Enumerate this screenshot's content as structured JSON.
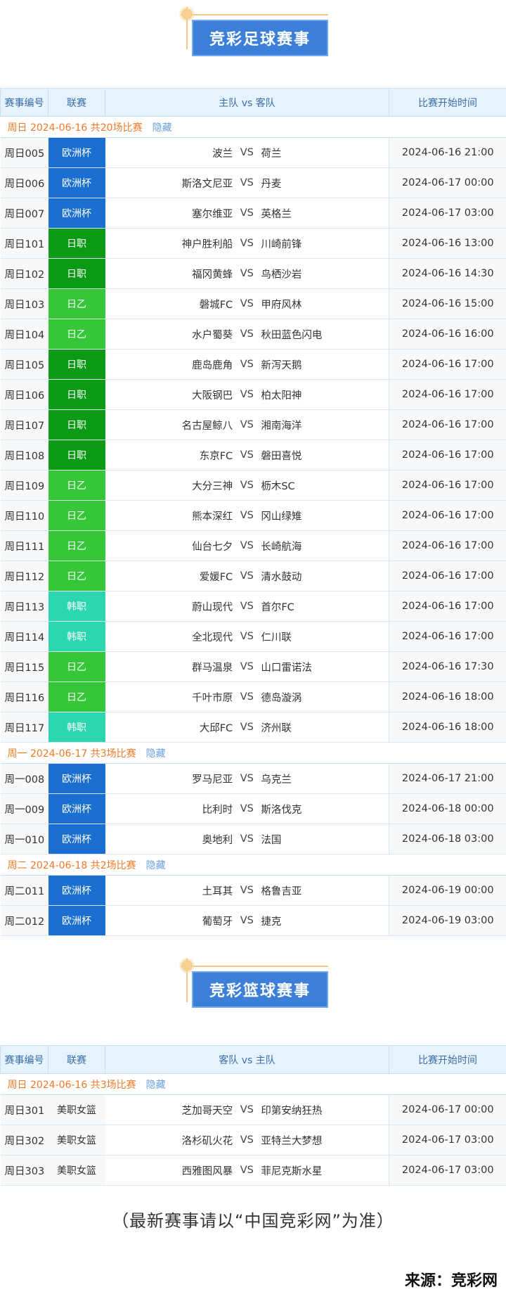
{
  "football": {
    "title": "竞彩足球赛事",
    "headers": [
      "赛事编号",
      "联赛",
      "主队 vs 客队",
      "比赛开始时间"
    ],
    "hide_label": "隐藏",
    "groups": [
      {
        "date_label": "周日 2024-06-16 共20场比赛",
        "matches": [
          {
            "num": "周日005",
            "league": "欧洲杯",
            "lg": "euro",
            "home": "波兰",
            "away": "荷兰",
            "time": "2024-06-16 21:00"
          },
          {
            "num": "周日006",
            "league": "欧洲杯",
            "lg": "euro",
            "home": "斯洛文尼亚",
            "away": "丹麦",
            "time": "2024-06-17 00:00"
          },
          {
            "num": "周日007",
            "league": "欧洲杯",
            "lg": "euro",
            "home": "塞尔维亚",
            "away": "英格兰",
            "time": "2024-06-17 03:00"
          },
          {
            "num": "周日101",
            "league": "日职",
            "lg": "j1",
            "home": "神户胜利船",
            "away": "川崎前锋",
            "time": "2024-06-16 13:00"
          },
          {
            "num": "周日102",
            "league": "日职",
            "lg": "j1",
            "home": "福冈黄蜂",
            "away": "鸟栖沙岩",
            "time": "2024-06-16 14:30"
          },
          {
            "num": "周日103",
            "league": "日乙",
            "lg": "j2",
            "home": "磐城FC",
            "away": "甲府风林",
            "time": "2024-06-16 15:00"
          },
          {
            "num": "周日104",
            "league": "日乙",
            "lg": "j2",
            "home": "水户蜀葵",
            "away": "秋田蓝色闪电",
            "time": "2024-06-16 16:00"
          },
          {
            "num": "周日105",
            "league": "日职",
            "lg": "j1",
            "home": "鹿岛鹿角",
            "away": "新泻天鹅",
            "time": "2024-06-16 17:00"
          },
          {
            "num": "周日106",
            "league": "日职",
            "lg": "j1",
            "home": "大阪钢巴",
            "away": "柏太阳神",
            "time": "2024-06-16 17:00"
          },
          {
            "num": "周日107",
            "league": "日职",
            "lg": "j1",
            "home": "名古屋鲸八",
            "away": "湘南海洋",
            "time": "2024-06-16 17:00"
          },
          {
            "num": "周日108",
            "league": "日职",
            "lg": "j1",
            "home": "东京FC",
            "away": "磐田喜悦",
            "time": "2024-06-16 17:00"
          },
          {
            "num": "周日109",
            "league": "日乙",
            "lg": "j2",
            "home": "大分三神",
            "away": "枥木SC",
            "time": "2024-06-16 17:00"
          },
          {
            "num": "周日110",
            "league": "日乙",
            "lg": "j2",
            "home": "熊本深红",
            "away": "冈山绿雉",
            "time": "2024-06-16 17:00"
          },
          {
            "num": "周日111",
            "league": "日乙",
            "lg": "j2",
            "home": "仙台七夕",
            "away": "长崎航海",
            "time": "2024-06-16 17:00"
          },
          {
            "num": "周日112",
            "league": "日乙",
            "lg": "j2",
            "home": "爱媛FC",
            "away": "清水鼓动",
            "time": "2024-06-16 17:00"
          },
          {
            "num": "周日113",
            "league": "韩职",
            "lg": "k1",
            "home": "蔚山现代",
            "away": "首尔FC",
            "time": "2024-06-16 17:00"
          },
          {
            "num": "周日114",
            "league": "韩职",
            "lg": "k1",
            "home": "全北现代",
            "away": "仁川联",
            "time": "2024-06-16 17:00"
          },
          {
            "num": "周日115",
            "league": "日乙",
            "lg": "j2",
            "home": "群马温泉",
            "away": "山口雷诺法",
            "time": "2024-06-16 17:30"
          },
          {
            "num": "周日116",
            "league": "日乙",
            "lg": "j2",
            "home": "千叶市原",
            "away": "德岛漩涡",
            "time": "2024-06-16 18:00"
          },
          {
            "num": "周日117",
            "league": "韩职",
            "lg": "k1",
            "home": "大邱FC",
            "away": "济州联",
            "time": "2024-06-16 18:00"
          }
        ]
      },
      {
        "date_label": "周一 2024-06-17 共3场比赛",
        "matches": [
          {
            "num": "周一008",
            "league": "欧洲杯",
            "lg": "euro",
            "home": "罗马尼亚",
            "away": "乌克兰",
            "time": "2024-06-17 21:00"
          },
          {
            "num": "周一009",
            "league": "欧洲杯",
            "lg": "euro",
            "home": "比利时",
            "away": "斯洛伐克",
            "time": "2024-06-18 00:00"
          },
          {
            "num": "周一010",
            "league": "欧洲杯",
            "lg": "euro",
            "home": "奥地利",
            "away": "法国",
            "time": "2024-06-18 03:00"
          }
        ]
      },
      {
        "date_label": "周二 2024-06-18 共2场比赛",
        "matches": [
          {
            "num": "周二011",
            "league": "欧洲杯",
            "lg": "euro",
            "home": "土耳其",
            "away": "格鲁吉亚",
            "time": "2024-06-19 00:00"
          },
          {
            "num": "周二012",
            "league": "欧洲杯",
            "lg": "euro",
            "home": "葡萄牙",
            "away": "捷克",
            "time": "2024-06-19 03:00"
          }
        ]
      }
    ]
  },
  "basketball": {
    "title": "竞彩篮球赛事",
    "headers": [
      "赛事编号",
      "联赛",
      "客队 vs 主队",
      "比赛开始时间"
    ],
    "hide_label": "隐藏",
    "groups": [
      {
        "date_label": "周日 2024-06-16 共3场比赛",
        "matches": [
          {
            "num": "周日301",
            "league": "美职女篮",
            "lg": "wnba",
            "home": "芝加哥天空",
            "away": "印第安纳狂热",
            "time": "2024-06-17 00:00"
          },
          {
            "num": "周日302",
            "league": "美职女篮",
            "lg": "wnba",
            "home": "洛杉矶火花",
            "away": "亚特兰大梦想",
            "time": "2024-06-17 03:00"
          },
          {
            "num": "周日303",
            "league": "美职女篮",
            "lg": "wnba",
            "home": "西雅图风暴",
            "away": "菲尼克斯水星",
            "time": "2024-06-17 03:00"
          }
        ]
      }
    ]
  },
  "vs_label": "VS",
  "footer": {
    "note": "（最新赛事请以“中国竞彩网”为准）",
    "source": "来源：竞彩网"
  },
  "colors": {
    "euro": "#1b6fd0",
    "j1": "#0a9a16",
    "j2": "#35c738",
    "k1": "#2bd6b0",
    "title_bg": "#3b7fd8",
    "date_text": "#f07a28"
  }
}
